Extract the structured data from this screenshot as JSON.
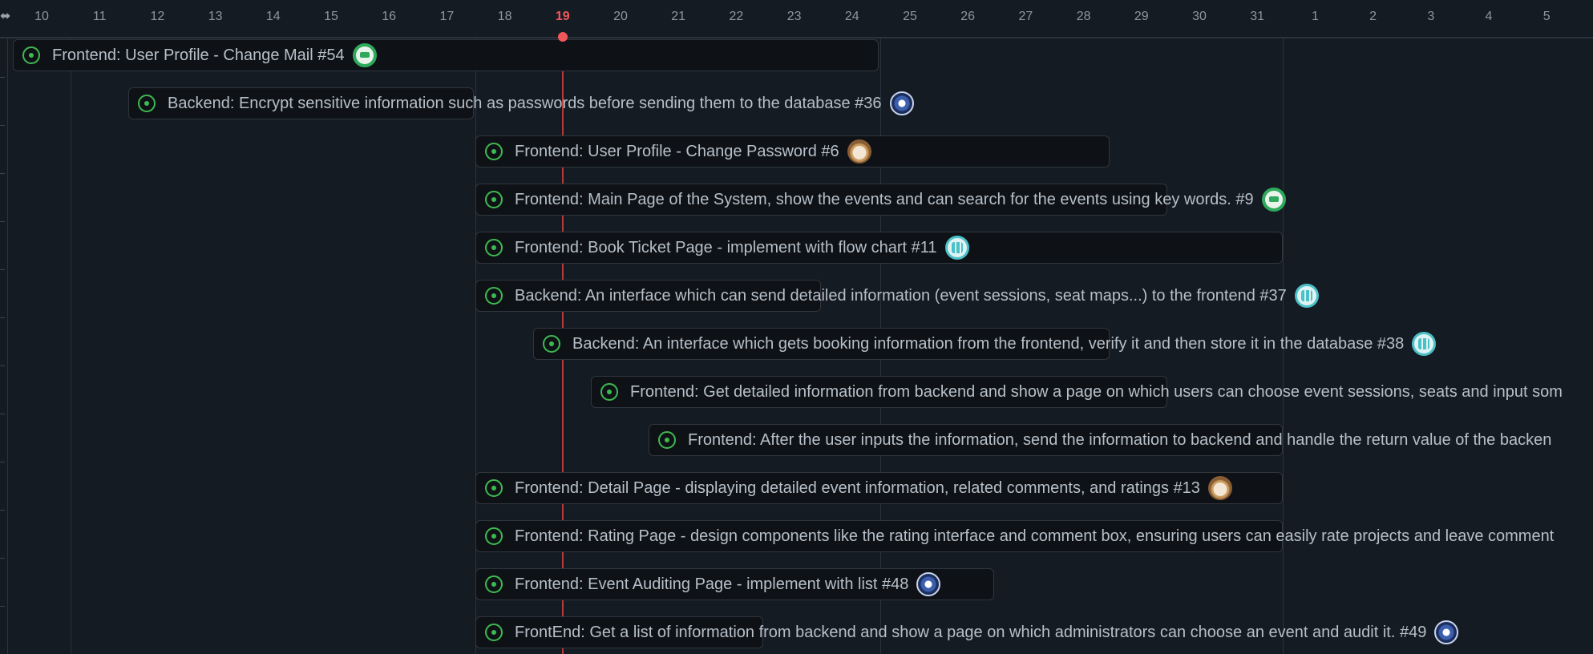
{
  "timeline": {
    "handle_icon": "resize-handle-icon",
    "today": "19",
    "days": [
      "10",
      "11",
      "12",
      "13",
      "14",
      "15",
      "16",
      "17",
      "18",
      "19",
      "20",
      "21",
      "22",
      "23",
      "24",
      "25",
      "26",
      "27",
      "28",
      "29",
      "30",
      "31",
      "1",
      "2",
      "3",
      "4",
      "5"
    ]
  },
  "items": [
    {
      "title": "Frontend: User Profile - Change Mail #54",
      "status_icon": "issue-open-icon",
      "avatar": "green",
      "status_color": "#3fb950"
    },
    {
      "title": "Backend: Encrypt sensitive information such as passwords before sending them to the database #36",
      "status_icon": "issue-open-icon",
      "avatar": "blue"
    },
    {
      "title": "Frontend: User Profile - Change Password #6",
      "status_icon": "issue-open-icon",
      "avatar": "doll"
    },
    {
      "title": "Frontend: Main Page of the System, show the events and can search for the events using key words. #9",
      "status_icon": "issue-open-icon",
      "avatar": "green"
    },
    {
      "title": "Frontend: Book Ticket Page - implement with flow chart #11",
      "status_icon": "issue-open-icon",
      "avatar": "teal"
    },
    {
      "title": "Backend: An interface which can send detailed information (event sessions, seat maps...) to the frontend #37",
      "status_icon": "issue-open-icon",
      "avatar": "teal"
    },
    {
      "title": "Backend: An interface which gets booking information from the frontend, verify it and then store it in the database #38",
      "status_icon": "issue-open-icon",
      "avatar": "teal"
    },
    {
      "title": "Frontend: Get detailed information from backend and show a page on which users can choose event sessions, seats and input som",
      "status_icon": "issue-open-icon",
      "avatar": ""
    },
    {
      "title": "Frontend: After the user inputs the information, send the information to backend and handle the return value of the backen",
      "status_icon": "issue-open-icon",
      "avatar": ""
    },
    {
      "title": "Frontend: Detail Page - displaying detailed event information, related comments, and ratings #13",
      "status_icon": "issue-open-icon",
      "avatar": "doll"
    },
    {
      "title": "Frontend: Rating Page - design components like the rating interface and comment box, ensuring users can easily rate projects and leave comment",
      "status_icon": "issue-open-icon",
      "avatar": ""
    },
    {
      "title": "Frontend: Event Auditing Page - implement with list #48",
      "status_icon": "issue-open-icon",
      "avatar": "blue"
    },
    {
      "title": "FrontEnd: Get a list of information from backend and show a page on which administrators can choose an event and audit it. #49",
      "status_icon": "issue-open-icon",
      "avatar": "blue"
    }
  ],
  "colors": {
    "background": "#151b23",
    "today": "#f0575a",
    "open_status": "#3fb950"
  }
}
